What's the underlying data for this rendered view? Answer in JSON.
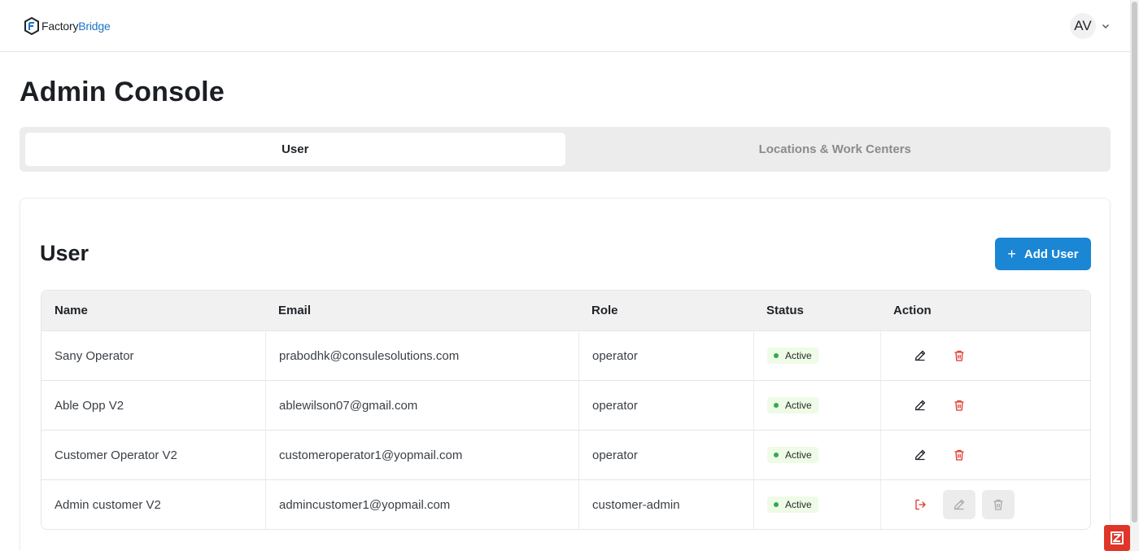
{
  "header": {
    "logo_text_a": "Factory",
    "logo_text_b": "Bridge",
    "avatar_initials": "AV"
  },
  "page": {
    "title": "Admin Console"
  },
  "tabs": [
    {
      "label": "User",
      "active": true
    },
    {
      "label": "Locations & Work Centers",
      "active": false
    }
  ],
  "card": {
    "title": "User",
    "add_button_label": "Add User"
  },
  "table": {
    "columns": [
      "Name",
      "Email",
      "Role",
      "Status",
      "Action"
    ],
    "rows": [
      {
        "name": "Sany Operator",
        "email": "prabodhk@consulesolutions.com",
        "role": "operator",
        "status": "Active"
      },
      {
        "name": "Able Opp V2",
        "email": "ablewilson07@gmail.com",
        "role": "operator",
        "status": "Active"
      },
      {
        "name": "Customer Operator V2",
        "email": "customeroperator1@yopmail.com",
        "role": "operator",
        "status": "Active"
      },
      {
        "name": "Admin customer V2",
        "email": "admincustomer1@yopmail.com",
        "role": "customer-admin",
        "status": "Active"
      }
    ]
  },
  "colors": {
    "accent": "#1a86d4",
    "delete": "#e0362a",
    "logout": "#e0362a",
    "status_active": "#34a853"
  }
}
